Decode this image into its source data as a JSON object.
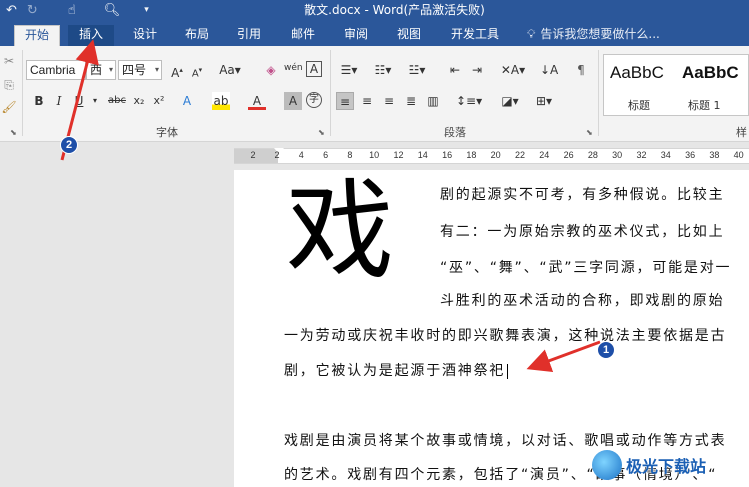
{
  "window": {
    "title": "散文.docx - Word(产品激活失败)",
    "qat_icons": [
      "undo-icon",
      "redo-icon",
      "touch-mode-icon",
      "print-preview-icon",
      "customize-qat-icon"
    ]
  },
  "tabs": [
    {
      "label": "开始",
      "state": "active"
    },
    {
      "label": "插入",
      "state": "highlighted"
    },
    {
      "label": "设计",
      "state": "normal"
    },
    {
      "label": "布局",
      "state": "normal"
    },
    {
      "label": "引用",
      "state": "normal"
    },
    {
      "label": "邮件",
      "state": "normal"
    },
    {
      "label": "审阅",
      "state": "normal"
    },
    {
      "label": "视图",
      "state": "normal"
    },
    {
      "label": "开发工具",
      "state": "normal"
    }
  ],
  "tell_me": {
    "icon": "lightbulb-icon",
    "placeholder": "告诉我您想要做什么..."
  },
  "ribbon": {
    "font": {
      "label": "字体",
      "font_name": "Cambria",
      "font_east_asian": "西",
      "font_size": "四号",
      "buttons_row1": [
        "A↑",
        "A↓",
        "Aa",
        "清除",
        "wén",
        "A"
      ],
      "buttons_row2": [
        "B",
        "I",
        "U",
        "abc",
        "x₂",
        "x²",
        "A",
        "ab",
        "A",
        "A",
        "字"
      ]
    },
    "paragraph": {
      "label": "段落"
    },
    "styles": {
      "label": "样",
      "items": [
        {
          "sample": "AaBbC",
          "name": "标题"
        },
        {
          "sample": "AaBbC",
          "name": "标题 1"
        }
      ]
    }
  },
  "ruler": {
    "numbers": [
      "2",
      "2",
      "4",
      "6",
      "8",
      "10",
      "12",
      "14",
      "16",
      "18",
      "20",
      "22",
      "24",
      "26",
      "28",
      "30",
      "32",
      "34",
      "36",
      "38",
      "40"
    ]
  },
  "document": {
    "drop_cap": "戏",
    "lines_beside_dropcap": [
      "剧的起源实不可考，有多种假说。比较主",
      "有二：一为原始宗教的巫术仪式，比如上",
      "“巫”、“舞”、“武”三字同源，可能是对一",
      "斗胜利的巫术活动的合称，即戏剧的原始"
    ],
    "lines_full": [
      "一为劳动或庆祝丰收时的即兴歌舞表演，这种说法主要依据是古",
      "剧，它被认为是起源于酒神祭祀"
    ],
    "paragraph2": [
      "戏剧是由演员将某个故事或情境，以对话、歌唱或动作等方式表",
      "的艺术。戏剧有四个元素，包括了“演员”、“故事（情境）”、“"
    ]
  },
  "annotations": [
    {
      "label": "1",
      "color": "#e0302a"
    },
    {
      "label": "2",
      "color": "#e0302a"
    }
  ],
  "watermark": {
    "text": "极光下载站"
  },
  "colors": {
    "title_bar": "#2b579a",
    "ribbon_bg": "#f3f3f3",
    "arrow": "#e0302a",
    "badge": "#1e4fa8"
  }
}
